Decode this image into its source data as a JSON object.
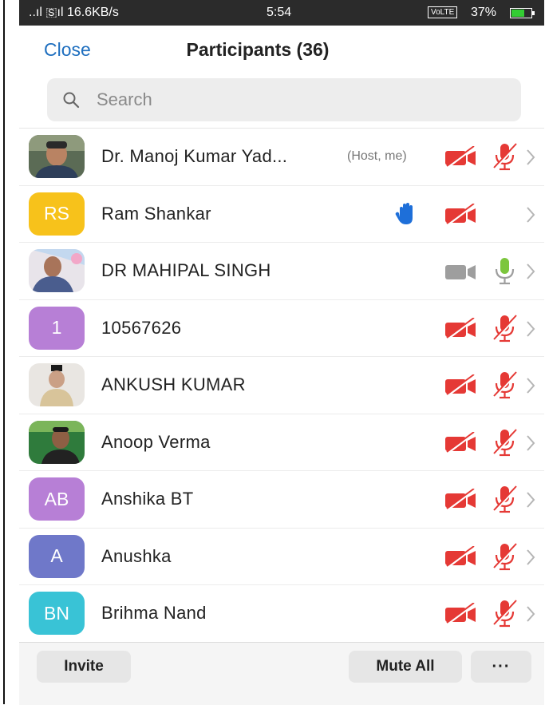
{
  "status_bar": {
    "left": "..ıl 🇸ıl 16.6KB/s",
    "time": "5:54",
    "volte": "VoLTE",
    "battery": "37%"
  },
  "header": {
    "close_label": "Close",
    "title": "Participants (36)"
  },
  "search": {
    "placeholder": "Search"
  },
  "participants": [
    {
      "name": "Dr. Manoj Kumar Yad...",
      "tag": "(Host, me)",
      "avatar_type": "photo",
      "video": "off",
      "audio": "muted"
    },
    {
      "name": "Ram Shankar",
      "initials": "RS",
      "avatar_color": "#f7c21b",
      "raised_hand": true,
      "video": "off",
      "audio": "none"
    },
    {
      "name": "DR MAHIPAL SINGH",
      "avatar_type": "photo",
      "video": "on",
      "audio": "on"
    },
    {
      "name": "10567626",
      "initials": "1",
      "avatar_color": "#b77fd6",
      "video": "off",
      "audio": "muted"
    },
    {
      "name": "ANKUSH KUMAR",
      "avatar_type": "photo",
      "video": "off",
      "audio": "muted"
    },
    {
      "name": "Anoop Verma",
      "avatar_type": "photo",
      "video": "off",
      "audio": "muted"
    },
    {
      "name": "Anshika BT",
      "initials": "AB",
      "avatar_color": "#b77fd6",
      "video": "off",
      "audio": "muted"
    },
    {
      "name": "Anushka",
      "initials": "A",
      "avatar_color": "#6f78c9",
      "video": "off",
      "audio": "muted"
    },
    {
      "name": "Brihma Nand",
      "initials": "BN",
      "avatar_color": "#39c3d6",
      "video": "off",
      "audio": "muted"
    }
  ],
  "footer": {
    "invite_label": "Invite",
    "mute_all_label": "Mute All",
    "more_label": "···"
  },
  "colors": {
    "accent": "#1f6fbf",
    "muted_red": "#e53935",
    "active_green": "#7cc63d",
    "camera_on_gray": "#9e9e9e",
    "hand_blue": "#1e6fd9"
  }
}
